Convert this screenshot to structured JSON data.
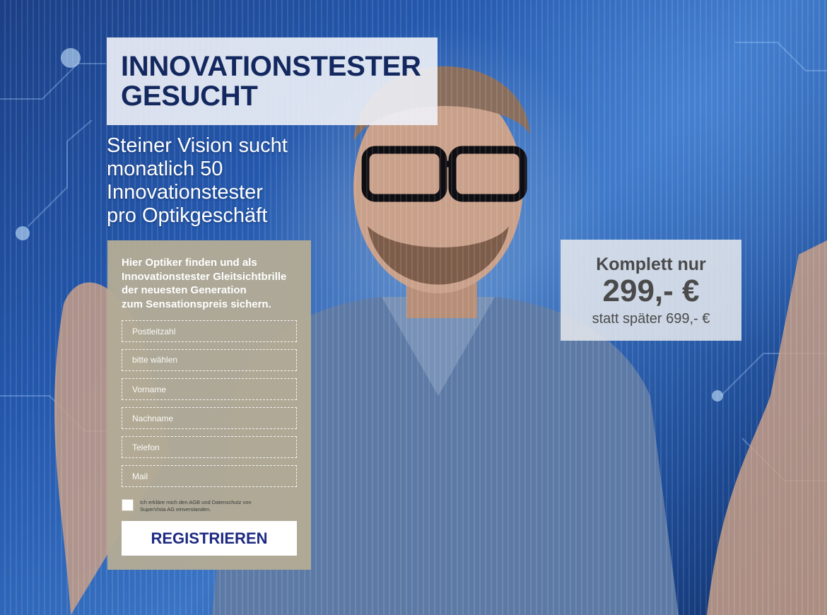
{
  "headline": {
    "lines": [
      "INNOVATIONSTESTER",
      "GESUCHT"
    ]
  },
  "subheadline": {
    "lines": [
      "Steiner Vision sucht",
      "monatlich 50",
      "Innovationstester",
      "pro Optikgeschäft"
    ]
  },
  "form": {
    "intro_lines": [
      "Hier Optiker finden und als",
      "Innovationstester Gleitsichtbrille",
      "der neuesten Generation",
      "zum Sensationspreis sichern."
    ],
    "fields": {
      "postcode": {
        "placeholder": "Postleitzahl",
        "value": ""
      },
      "optician_select": {
        "selected": "bitte wählen"
      },
      "firstname": {
        "placeholder": "Vorname",
        "value": ""
      },
      "lastname": {
        "placeholder": "Nachname",
        "value": ""
      },
      "phone": {
        "placeholder": "Telefon",
        "value": ""
      },
      "mail": {
        "placeholder": "Mail",
        "value": ""
      }
    },
    "consent": {
      "checked": false,
      "lines": [
        "Ich erkläre mich den AGB und Datenschutz von",
        "SuperVista AG einverstanden."
      ]
    },
    "submit_label": "REGISTRIEREN"
  },
  "price": {
    "lead": "Komplett nur",
    "main": "299,- €",
    "old": "statt später 699,- €"
  },
  "colors": {
    "headline_text": "#13285e",
    "form_panel": "#b2aa96",
    "button_text": "#1d2a82",
    "price_text": "#4a4a4a"
  }
}
